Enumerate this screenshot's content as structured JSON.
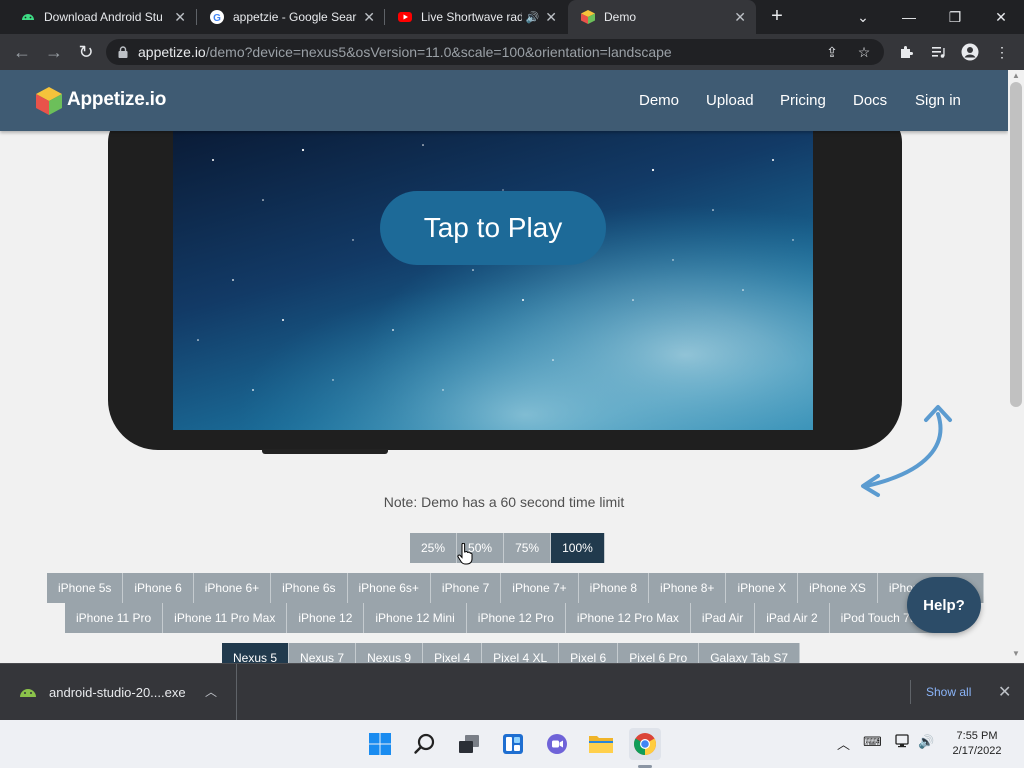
{
  "browser": {
    "tabs": [
      {
        "title": "Download Android Stu",
        "icon": "android-icon"
      },
      {
        "title": "appetzie - Google Sear",
        "icon": "google-icon"
      },
      {
        "title": "Live Shortwave rad",
        "icon": "youtube-icon"
      },
      {
        "title": "Demo",
        "icon": "appetize-cube-icon",
        "active": true
      }
    ],
    "url_host": "appetize.io",
    "url_path": "/demo?device=nexus5&osVersion=11.0&scale=100&orientation=landscape"
  },
  "site": {
    "brand": "Appetize.io",
    "nav": [
      "Demo",
      "Upload",
      "Pricing",
      "Docs",
      "Sign in"
    ],
    "play_button": "Tap to Play",
    "note": "Note: Demo has a 60 second time limit",
    "scales": [
      "25%",
      "50%",
      "75%",
      "100%"
    ],
    "active_scale": "100%",
    "devices_row1": [
      "iPhone 5s",
      "iPhone 6",
      "iPhone 6+",
      "iPhone 6s",
      "iPhone 6s+",
      "iPhone 7",
      "iPhone 7+",
      "iPhone 8",
      "iPhone 8+",
      "iPhone X",
      "iPhone XS",
      "iPhone XS Max"
    ],
    "devices_row2": [
      "iPhone 11 Pro",
      "iPhone 11 Pro Max",
      "iPhone 12",
      "iPhone 12 Mini",
      "iPhone 12 Pro",
      "iPhone 12 Pro Max",
      "iPad Air",
      "iPad Air 2",
      "iPod Touch 7th Gen"
    ],
    "devices_row3": [
      "Nexus 5",
      "Nexus 7",
      "Nexus 9",
      "Pixel 4",
      "Pixel 4 XL",
      "Pixel 6",
      "Pixel 6 Pro",
      "Galaxy Tab S7"
    ],
    "active_device": "Nexus 5",
    "help": "Help?"
  },
  "downloads": {
    "file": "android-studio-20....exe",
    "show_all": "Show all"
  },
  "taskbar": {
    "apps": [
      "windows-start-icon",
      "search-icon",
      "task-view-icon",
      "widgets-icon",
      "teams-chat-icon",
      "file-explorer-icon",
      "chrome-icon"
    ],
    "time": "7:55 PM",
    "date": "2/17/2022"
  }
}
